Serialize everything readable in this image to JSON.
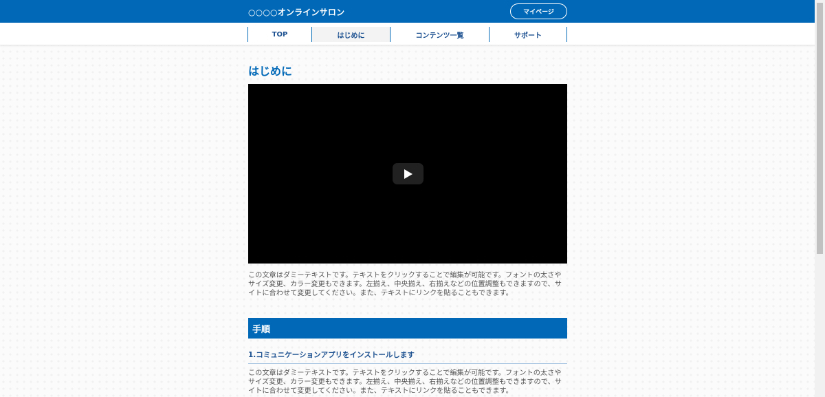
{
  "header": {
    "site_title": "○○○○オンラインサロン",
    "mypage_label": "マイページ",
    "brand_color": "#0068b7"
  },
  "nav": {
    "items": [
      {
        "label": "TOP"
      },
      {
        "label": "はじめに",
        "active": true
      },
      {
        "label": "コンテンツ一覧"
      },
      {
        "label": "サポート"
      }
    ]
  },
  "main": {
    "heading": "はじめに",
    "video": {
      "control": "play-icon"
    },
    "intro_text": "この文章はダミーテキストです。テキストをクリックすることで編集が可能です。フォントの太さやサイズ変更、カラー変更もできます。左揃え、中央揃え、右揃えなどの位置調整もできますので、サイトに合わせて変更してください。また、テキストにリンクを貼ることもできます。",
    "section": {
      "title": "手順",
      "steps": [
        {
          "title": "1.コミュニケーションアプリをインストールします",
          "text": "この文章はダミーテキストです。テキストをクリックすることで編集が可能です。フォントの太さやサイズ変更、カラー変更もできます。左揃え、中央揃え、右揃えなどの位置調整もできますので、サイトに合わせて変更してください。また、テキストにリンクを貼ることもできます。"
        }
      ]
    }
  }
}
